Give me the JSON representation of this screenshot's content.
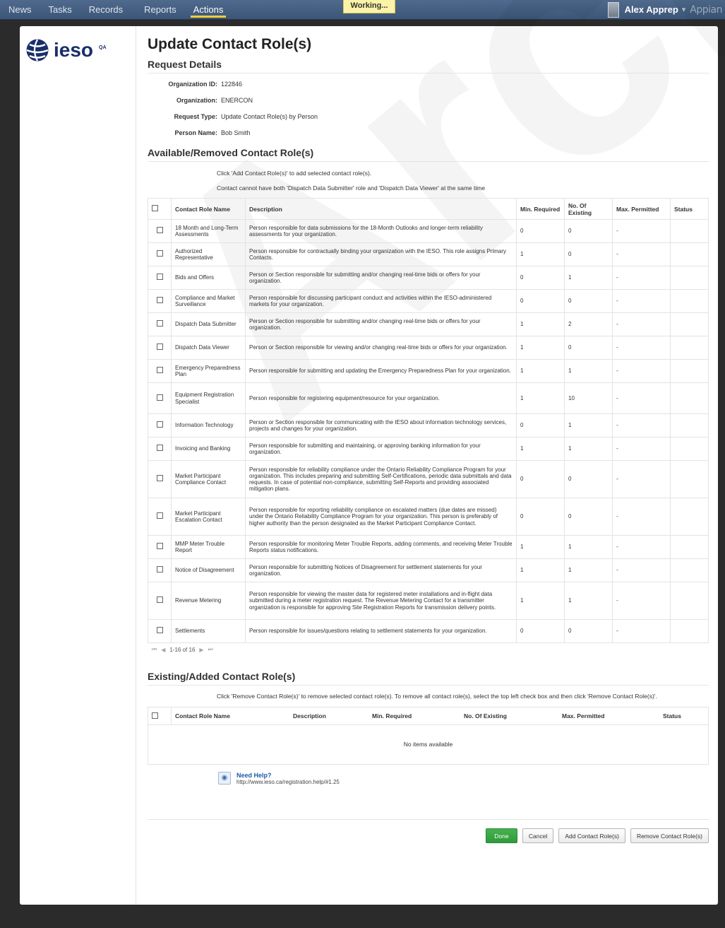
{
  "topbar": {
    "nav": [
      "News",
      "Tasks",
      "Records",
      "Reports",
      "Actions"
    ],
    "active": "Actions",
    "working_label": "Working...",
    "user_name": "Alex Apprep",
    "user_caret": "▾",
    "brand": "Appian"
  },
  "logo": {
    "text": "ieso",
    "badge": "QA"
  },
  "page": {
    "title": "Update Contact Role(s)",
    "request_details": {
      "heading": "Request Details",
      "fields": [
        {
          "label": "Organization ID:",
          "value": "122846"
        },
        {
          "label": "Organization:",
          "value": "ENERCON"
        },
        {
          "label": "Request Type:",
          "value": "Update Contact Role(s) by Person"
        },
        {
          "label": "Person Name:",
          "value": "Bob Smith"
        }
      ]
    },
    "available": {
      "heading": "Available/Removed Contact Role(s)",
      "info1": "Click 'Add Contact Role(s)' to add selected contact role(s).",
      "info2": "Contact cannot have both 'Dispatch Data Submitter' role and 'Dispatch Data Viewer' at the same time",
      "columns": [
        "Contact Role Name",
        "Description",
        "Min. Required",
        "No. Of Existing",
        "Max. Permitted",
        "Status"
      ],
      "rows": [
        {
          "name": "18 Month and Long-Term Assessments",
          "desc": "Person responsible for data submissions for the 18-Month Outlooks and longer-term reliability assessments for your organization.",
          "min": "0",
          "existing": "0",
          "max": "-",
          "status": ""
        },
        {
          "name": "Authorized Representative",
          "desc": "Person responsible for contractually binding your organization with the IESO. This role assigns Primary Contacts.",
          "min": "1",
          "existing": "0",
          "max": "-",
          "status": ""
        },
        {
          "name": "Bids and Offers",
          "desc": "Person or Section responsible for submitting and/or changing real-time bids or offers for your organization.",
          "min": "0",
          "existing": "1",
          "max": "-",
          "status": ""
        },
        {
          "name": "Compliance and Market Surveillance",
          "desc": "Person responsible for discussing participant conduct and activities within the IESO-administered markets for your organization.",
          "min": "0",
          "existing": "0",
          "max": "-",
          "status": ""
        },
        {
          "name": "Dispatch Data Submitter",
          "desc": "Person or Section responsible for submitting and/or changing real-time bids or offers for your organization.",
          "min": "1",
          "existing": "2",
          "max": "-",
          "status": ""
        },
        {
          "name": "Dispatch Data Viewer",
          "desc": "Person or Section responsible for viewing and/or changing real-time bids or offers for your organization.",
          "min": "1",
          "existing": "0",
          "max": "-",
          "status": ""
        },
        {
          "name": "Emergency Preparedness Plan",
          "desc": "Person responsible for submitting and updating the Emergency Preparedness Plan for your organization.",
          "min": "1",
          "existing": "1",
          "max": "-",
          "status": ""
        },
        {
          "name": "Equipment Registration Specialist",
          "desc": "Person responsible for registering equipment/resource for your organization.",
          "min": "1",
          "existing": "10",
          "max": "-",
          "status": ""
        },
        {
          "name": "Information Technology",
          "desc": "Person or Section responsible for communicating with the IESO about information technology services, projects and changes for your organization.",
          "min": "0",
          "existing": "1",
          "max": "-",
          "status": ""
        },
        {
          "name": "Invoicing and Banking",
          "desc": "Person responsible for submitting and maintaining, or approving banking information for your organization.",
          "min": "1",
          "existing": "1",
          "max": "-",
          "status": ""
        },
        {
          "name": "Market Participant Compliance Contact",
          "desc": "Person responsible for reliability compliance under the Ontario Reliability Compliance Program for your organization. This includes preparing and submitting Self-Certifications, periodic data submittals and data requests. In case of potential non-compliance, submitting Self-Reports and providing associated mitigation plans.",
          "min": "0",
          "existing": "0",
          "max": "-",
          "status": ""
        },
        {
          "name": "Market Participant Escalation Contact",
          "desc": "Person responsible for reporting reliability compliance on escalated matters (due dates are missed) under the Ontario Reliability Compliance Program for your organization. This person is preferably of higher authority than the person designated as the Market Participant Compliance Contact.",
          "min": "0",
          "existing": "0",
          "max": "-",
          "status": ""
        },
        {
          "name": "MMP Meter Trouble Report",
          "desc": "Person responsible for monitoring Meter Trouble Reports, adding comments, and receiving Meter Trouble Reports status notifications.",
          "min": "1",
          "existing": "1",
          "max": "-",
          "status": ""
        },
        {
          "name": "Notice of Disagreement",
          "desc": "Person responsible for submitting Notices of Disagreement for settlement statements for your organization.",
          "min": "1",
          "existing": "1",
          "max": "-",
          "status": ""
        },
        {
          "name": "Revenue Metering",
          "desc": "Person responsible for viewing the master data for registered meter installations and in-flight data submitted during a meter registration request. The Revenue Metering Contact for a transmitter organization is responsible for approving Site Registration Reports for transmission delivery points.",
          "min": "1",
          "existing": "1",
          "max": "-",
          "status": ""
        },
        {
          "name": "Settlements",
          "desc": "Person responsible for issues/questions relating to settlement statements for your organization.",
          "min": "0",
          "existing": "0",
          "max": "-",
          "status": ""
        }
      ],
      "pager_text": "1-16 of 16"
    },
    "existing": {
      "heading": "Existing/Added Contact Role(s)",
      "info": "Click 'Remove Contact Role(s)' to remove selected contact role(s).  To remove all contact role(s), select the top left check box and then click 'Remove Contact Role(s)'.",
      "columns": [
        "Contact Role Name",
        "Description",
        "Min. Required",
        "No. Of Existing",
        "Max. Permitted",
        "Status"
      ],
      "empty": "No items available"
    },
    "help": {
      "title": "Need Help?",
      "link": "http://www.ieso.ca/registration.help/#1.25"
    },
    "buttons": {
      "done": "Done",
      "cancel": "Cancel",
      "add": "Add Contact Role(s)",
      "remove": "Remove Contact Role(s)"
    },
    "watermark": "Archive"
  }
}
